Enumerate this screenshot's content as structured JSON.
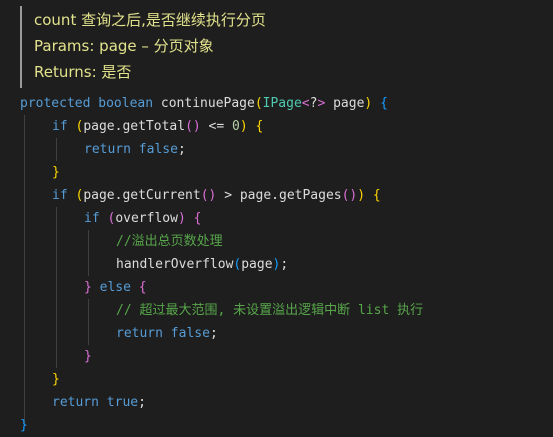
{
  "doc": {
    "line1": "count 查询之后,是否继续执行分页",
    "line2": "Params: page – 分页对象",
    "line3": "Returns: 是否"
  },
  "code": {
    "protected": "protected",
    "boolean": "boolean",
    "method": "continuePage",
    "paren_open_b": "(",
    "ipage": "IPage",
    "lt": "<",
    "q": "?",
    "gt": ">",
    "param": " page",
    "paren_close_b": ")",
    "brace_open_b": "{",
    "brace_close_b": "}",
    "if": "if",
    "paren_open_y": "(",
    "paren_close_y": ")",
    "brace_open_y": "{",
    "brace_close_y": "}",
    "paren_open_p": "(",
    "paren_close_p": ")",
    "brace_open_p": "{",
    "brace_close_p": "}",
    "empty_call": "()",
    "page_get_total": "page.getTotal",
    "le": "<=",
    "zero": "0",
    "return": "return",
    "false": "false",
    "true": "true",
    "semi": ";",
    "page_get_current": "page.getCurrent",
    "gt_op": ">",
    "page_get_pages": "page.getPages",
    "overflow": "overflow",
    "comment1": "//溢出总页数处理",
    "handler_call": "handlerOverflow",
    "page_arg": "page",
    "else": "else",
    "comment2": "// 超过最大范围, 未设置溢出逻辑中断 list 执行"
  }
}
